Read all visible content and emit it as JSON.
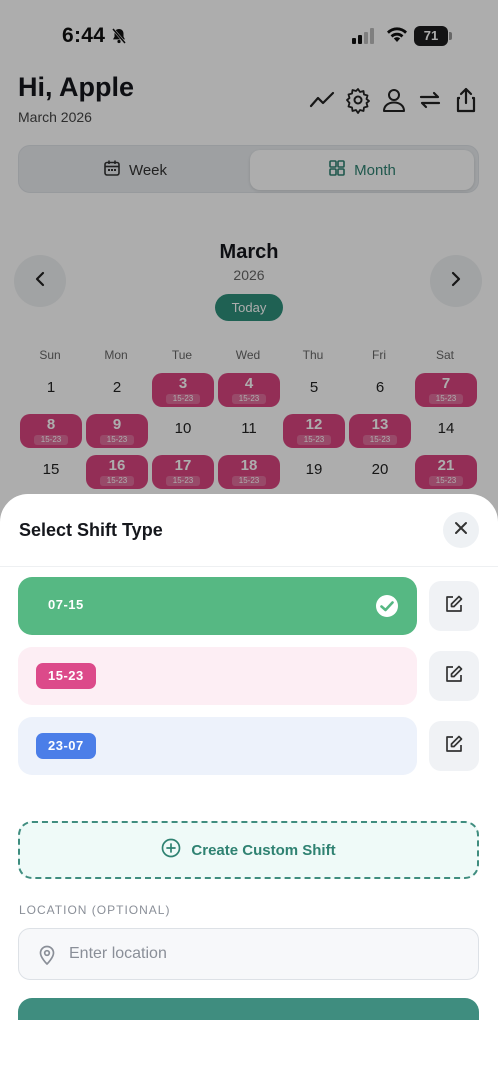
{
  "status_bar": {
    "time": "6:44",
    "battery": "71"
  },
  "header": {
    "greeting": "Hi, Apple",
    "subtitle": "March 2026"
  },
  "view_toggle": {
    "week_label": "Week",
    "month_label": "Month",
    "selected": "Month"
  },
  "calendar": {
    "month": "March",
    "year": "2026",
    "today_label": "Today",
    "weekdays": [
      "Sun",
      "Mon",
      "Tue",
      "Wed",
      "Thu",
      "Fri",
      "Sat"
    ],
    "shift_tag": "15-23",
    "weeks": [
      [
        {
          "d": "1"
        },
        {
          "d": "2"
        },
        {
          "d": "3",
          "s": true
        },
        {
          "d": "4",
          "s": true
        },
        {
          "d": "5"
        },
        {
          "d": "6"
        },
        {
          "d": "7",
          "s": true
        }
      ],
      [
        {
          "d": "8",
          "s": true
        },
        {
          "d": "9",
          "s": true
        },
        {
          "d": "10"
        },
        {
          "d": "11"
        },
        {
          "d": "12",
          "s": true
        },
        {
          "d": "13",
          "s": true
        },
        {
          "d": "14"
        }
      ],
      [
        {
          "d": "15"
        },
        {
          "d": "16",
          "s": true
        },
        {
          "d": "17",
          "s": true
        },
        {
          "d": "18",
          "s": true
        },
        {
          "d": "19"
        },
        {
          "d": "20"
        },
        {
          "d": "21",
          "s": true
        }
      ]
    ]
  },
  "sheet": {
    "title": "Select Shift Type",
    "shifts": [
      {
        "label": "07-15",
        "color": "#56b883",
        "selected": true
      },
      {
        "label": "15-23",
        "color": "#dc4a8a",
        "selected": false
      },
      {
        "label": "23-07",
        "color": "#4b7ee8",
        "selected": false
      }
    ],
    "create_label": "Create Custom Shift",
    "location_label": "LOCATION (OPTIONAL)",
    "location_placeholder": "Enter location",
    "location_value": ""
  }
}
